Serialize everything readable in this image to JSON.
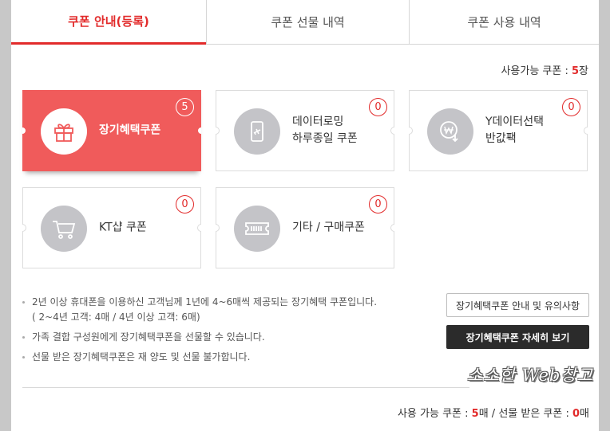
{
  "tabs": [
    {
      "label": "쿠폰 안내(등록)",
      "active": true
    },
    {
      "label": "쿠폰 선물 내역",
      "active": false
    },
    {
      "label": "쿠폰 사용 내역",
      "active": false
    }
  ],
  "available": {
    "prefix": "사용가능 쿠폰 : ",
    "count": "5",
    "unit": "장"
  },
  "coupons": [
    {
      "label": "장기혜택쿠폰",
      "count": "5",
      "icon": "gift-icon",
      "active": true
    },
    {
      "label": "데이터로밍\n하루종일 쿠폰",
      "count": "0",
      "icon": "phone-airplane-icon"
    },
    {
      "label": "Y데이터선택\n반값팩",
      "count": "0",
      "icon": "won-coin-icon"
    },
    {
      "label": "KT샵 쿠폰",
      "count": "0",
      "icon": "shopping-cart-icon"
    },
    {
      "label": "기타 / 구매쿠폰",
      "count": "0",
      "icon": "ticket-barcode-icon"
    }
  ],
  "notes": [
    "2년 이상 휴대폰을 이용하신 고객님께 1년에 4~6매씩 제공되는 장기혜택 쿠폰입니다.",
    "( 2~4년 고객: 4매 / 4년 이상 고객: 6매)",
    "가족 결합 구성원에게 장기혜택쿠폰을 선물할 수 있습니다.",
    "선물 받은 장기혜택쿠폰은 재 양도 및 선물 불가합니다."
  ],
  "buttons": {
    "guide": "장기혜택쿠폰 안내 및 유의사항",
    "detail": "장기혜택쿠폰 자세히 보기"
  },
  "watermark": "소소한 Web창고",
  "summary": {
    "available_label": "사용 가능 쿠폰 : ",
    "available_count": "5",
    "available_unit": "매",
    "separator": " / ",
    "gifted_label": "선물 받은 쿠폰 : ",
    "gifted_count": "0",
    "gifted_unit": "매"
  },
  "colors": {
    "accent": "#e22b2b",
    "active_card": "#f05b5b",
    "icon_circle": "#c4c4c8",
    "dark_button": "#2b2b2b"
  }
}
